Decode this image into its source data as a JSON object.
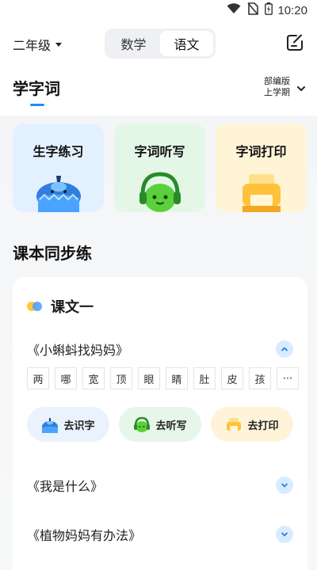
{
  "status_bar": {
    "time": "10:20",
    "icons": [
      "wifi-icon",
      "no-sim-icon",
      "battery-charging-icon"
    ]
  },
  "header": {
    "grade": "二年级",
    "subjects": [
      {
        "label": "数学",
        "active": false
      },
      {
        "label": "语文",
        "active": true
      }
    ],
    "edit_icon": "edit-icon"
  },
  "section_words": {
    "title": "学字词",
    "edition_line1": "部编版",
    "edition_line2": "上学期"
  },
  "feature_cards": [
    {
      "label": "生字练习",
      "icon": "pencil-mascot-icon"
    },
    {
      "label": "字词听写",
      "icon": "headphone-mascot-icon"
    },
    {
      "label": "字词打印",
      "icon": "printer-icon"
    }
  ],
  "section_sync": {
    "title": "课本同步练"
  },
  "lesson": {
    "name": "课文一",
    "texts": [
      {
        "title": "《小蝌蚪找妈妈》",
        "expanded": true
      },
      {
        "title": "《我是什么》",
        "expanded": false
      },
      {
        "title": "《植物妈妈有办法》",
        "expanded": false
      }
    ],
    "characters": [
      "两",
      "哪",
      "宽",
      "顶",
      "眼",
      "睛",
      "肚",
      "皮",
      "孩",
      "···"
    ],
    "actions": [
      {
        "label": "去识字",
        "icon": "pencil-mascot-icon"
      },
      {
        "label": "去听写",
        "icon": "headphone-mascot-icon"
      },
      {
        "label": "去打印",
        "icon": "printer-icon"
      }
    ]
  },
  "colors": {
    "accent": "#1c8bff",
    "card_blue": "#e3f0ff",
    "card_green": "#e4f7e6",
    "card_yellow": "#fff4d6"
  }
}
